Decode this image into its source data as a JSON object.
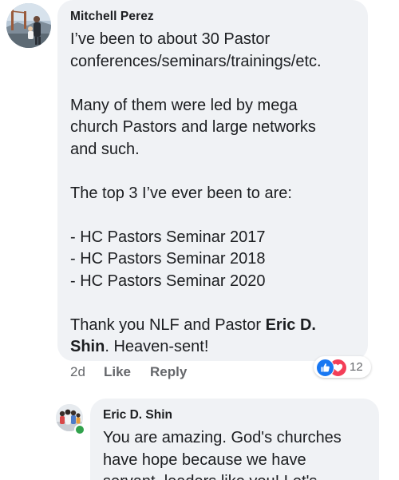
{
  "comment1": {
    "author": "Mitchell Perez",
    "lines": [
      "I’ve been to about 30 Pastor",
      "conferences/seminars/trainings/etc.",
      "",
      "Many of them were led by mega",
      "church Pastors and large networks",
      "and such.",
      "",
      "The top 3 I’ve ever been to are:",
      "",
      "- HC Pastors Seminar 2017",
      "- HC Pastors Seminar 2018",
      "- HC Pastors Seminar 2020",
      ""
    ],
    "closing": {
      "line1_prefix": "Thank you NLF and Pastor ",
      "line1_mention": "Eric D.",
      "line2_mention": "Shin",
      "line2_suffix": ". Heaven-sent!"
    },
    "time": "2d",
    "like_label": "Like",
    "reply_label": "Reply",
    "reaction_count": "12",
    "reaction_icons": [
      "like-icon",
      "love-icon"
    ],
    "colors": {
      "like": "#1877f2",
      "love": "#f33e58",
      "bubble": "#f0f2f5"
    }
  },
  "comment2": {
    "author": "Eric D. Shin",
    "lines": [
      "You are amazing. God's churches",
      "have hope because we have",
      "servant, leaders like you! Let's"
    ],
    "online": true,
    "colors": {
      "online": "#31a24c"
    }
  }
}
